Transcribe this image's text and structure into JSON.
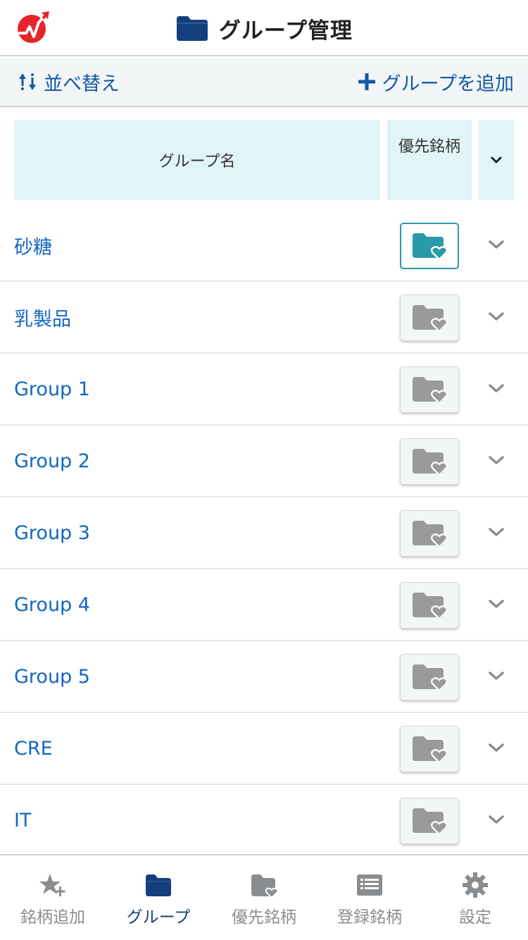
{
  "header": {
    "title": "グループ管理",
    "logo_icon": "trend-arrow-logo",
    "title_icon": "folder-icon"
  },
  "toolbar": {
    "sort_label": "並べ替え",
    "sort_icon": "sort-arrows-icon",
    "add_label": "グループを追加",
    "add_icon": "plus-icon"
  },
  "table": {
    "col_name": "グループ名",
    "col_priority": "優先銘柄",
    "col_toggle_icon": "chevron-down-icon"
  },
  "groups": [
    {
      "name": "砂糖",
      "priority_active": true
    },
    {
      "name": "乳製品",
      "priority_active": false
    },
    {
      "name": "Group 1",
      "priority_active": false
    },
    {
      "name": "Group 2",
      "priority_active": false
    },
    {
      "name": "Group 3",
      "priority_active": false
    },
    {
      "name": "Group 4",
      "priority_active": false
    },
    {
      "name": "Group 5",
      "priority_active": false
    },
    {
      "name": "CRE",
      "priority_active": false
    },
    {
      "name": "IT",
      "priority_active": false
    }
  ],
  "tabbar": {
    "active_index": 1,
    "tabs": [
      {
        "label": "銘柄追加",
        "icon": "star-plus-icon"
      },
      {
        "label": "グループ",
        "icon": "folder-icon"
      },
      {
        "label": "優先銘柄",
        "icon": "folder-heart-icon"
      },
      {
        "label": "登録銘柄",
        "icon": "list-icon"
      },
      {
        "label": "設定",
        "icon": "gear-icon"
      }
    ]
  },
  "colors": {
    "accent_blue": "#1358a8",
    "link_blue": "#1366c3",
    "brand_red": "#e6242b",
    "teal_active": "#2a9aa8",
    "header_cell_bg": "#dff5f8",
    "inactive_gray": "#8a8d90"
  }
}
